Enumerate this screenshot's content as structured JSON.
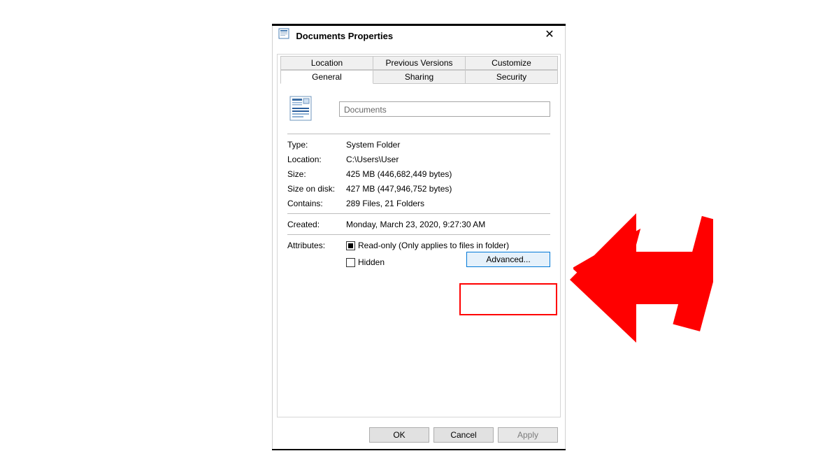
{
  "window": {
    "title": "Documents Properties",
    "close_glyph": "✕"
  },
  "tabs": {
    "row1": [
      "Location",
      "Previous Versions",
      "Customize"
    ],
    "row2": [
      "General",
      "Sharing",
      "Security"
    ],
    "active": "General"
  },
  "general": {
    "name_value": "Documents",
    "type_label": "Type:",
    "type_value": "System Folder",
    "location_label": "Location:",
    "location_value": "C:\\Users\\User",
    "size_label": "Size:",
    "size_value": "425 MB (446,682,449 bytes)",
    "size_on_disk_label": "Size on disk:",
    "size_on_disk_value": "427 MB (447,946,752 bytes)",
    "contains_label": "Contains:",
    "contains_value": "289 Files, 21 Folders",
    "created_label": "Created:",
    "created_value": "Monday, March 23, 2020, 9:27:30 AM",
    "attributes_label": "Attributes:",
    "readonly_label": "Read-only (Only applies to files in folder)",
    "hidden_label": "Hidden",
    "advanced_label": "Advanced..."
  },
  "buttons": {
    "ok": "OK",
    "cancel": "Cancel",
    "apply": "Apply"
  },
  "annotation": {
    "arrow_color": "#ff0000",
    "highlight_color": "#ff0000"
  }
}
